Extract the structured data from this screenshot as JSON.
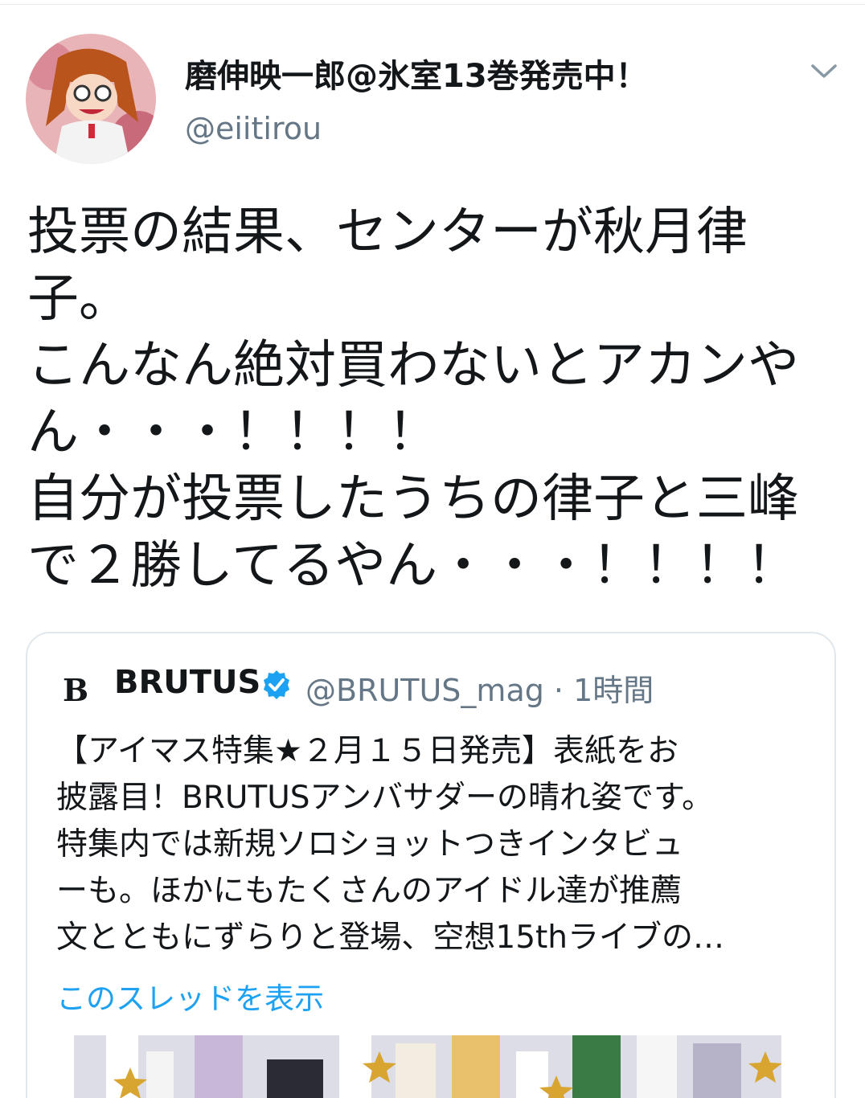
{
  "tweet": {
    "author_name": "磨伸映一郎@氷室13巻発売中！",
    "author_handle": "@eiitirou",
    "avatar_icon": "avatar-icon",
    "menu_icon": "chevron-down-icon",
    "text_lines": [
      "投票の結果、センターが秋月律",
      "子。",
      "こんなん絶対買わないとアカンや",
      "ん・・・！！！！",
      "自分が投票したうちの律子と三峰",
      "で２勝してるやん・・・！！！！"
    ]
  },
  "quoted_tweet": {
    "logo_text": "B",
    "author_name": "BRUTUS",
    "verified_icon": "verified-badge-icon",
    "handle_time": "@BRUTUS_mag · 1時間",
    "text_lines": [
      "【アイマス特集★２月１５日発売】表紙をお",
      "披露目！BRUTUSアンバサダーの晴れ姿です。",
      "特集内では新規ソロショットつきインタビュ",
      "ーも。ほかにもたくさんのアイドル達が推薦",
      "文とともにずらりと登場、空想15thライブの…"
    ],
    "thread_link": "このスレッドを表示",
    "media_icon": "cover-image"
  },
  "colors": {
    "text": "#14171a",
    "secondary": "#657786",
    "link": "#1da1f2",
    "border": "#e1e8ed",
    "verified": "#1da1f2"
  }
}
